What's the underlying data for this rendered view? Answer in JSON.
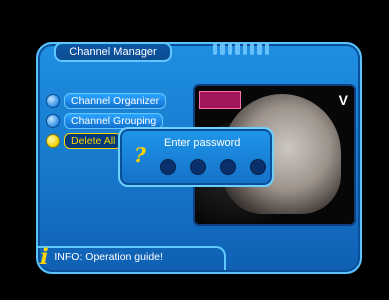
{
  "header": {
    "title": "Channel Manager"
  },
  "menu": {
    "items": [
      {
        "label": "Channel Organizer",
        "state": "inactive"
      },
      {
        "label": "Channel Grouping",
        "state": "inactive"
      },
      {
        "label": "Delete All",
        "state": "selected"
      }
    ]
  },
  "preview": {
    "logo_text": "",
    "channel_logo": "V"
  },
  "dialog": {
    "title": "Enter password",
    "icon": "question-mark-icon",
    "pin_length": 4
  },
  "info": {
    "text": "INFO: Operation guide!"
  },
  "colors": {
    "panel": "#1676c9",
    "border": "#59c4ff",
    "accent_yellow": "#ffd400",
    "pin_dot": "#0b2f6a"
  }
}
